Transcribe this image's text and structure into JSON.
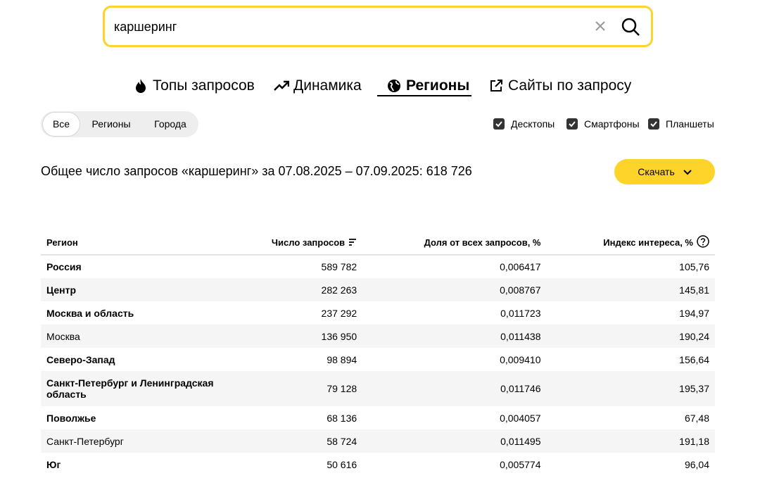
{
  "search": {
    "value": "каршеринг"
  },
  "tabs": [
    {
      "label": "Топы запросов",
      "icon": "fire-icon"
    },
    {
      "label": "Динамика",
      "icon": "trend-up-icon"
    },
    {
      "label": "Регионы",
      "icon": "globe-icon",
      "active": true
    },
    {
      "label": "Сайты по запросу",
      "icon": "external-link-icon"
    }
  ],
  "segments": [
    {
      "label": "Все",
      "active": true
    },
    {
      "label": "Регионы"
    },
    {
      "label": "Города"
    }
  ],
  "devices": [
    {
      "label": "Десктопы",
      "checked": true
    },
    {
      "label": "Смартфоны",
      "checked": true
    },
    {
      "label": "Планшеты",
      "checked": true
    }
  ],
  "summary": "Общее число запросов «каршеринг» за 07.08.2025 – 07.09.2025: 618 726",
  "download_label": "Скачать",
  "table": {
    "headers": {
      "region": "Регион",
      "count": "Число запросов",
      "share": "Доля от всех запросов, %",
      "index": "Индекс интереса, %"
    },
    "rows": [
      {
        "region": "Россия",
        "count": "589 782",
        "share": "0,006417",
        "index": "105,76",
        "bold": true
      },
      {
        "region": "Центр",
        "count": "282 263",
        "share": "0,008767",
        "index": "145,81",
        "bold": true
      },
      {
        "region": "Москва и область",
        "count": "237 292",
        "share": "0,011723",
        "index": "194,97",
        "bold": true
      },
      {
        "region": "Москва",
        "count": "136 950",
        "share": "0,011438",
        "index": "190,24",
        "bold": false
      },
      {
        "region": "Северо-Запад",
        "count": "98 894",
        "share": "0,009410",
        "index": "156,64",
        "bold": true
      },
      {
        "region": "Санкт-Петербург и Ленинградская область",
        "count": "79 128",
        "share": "0,011746",
        "index": "195,37",
        "bold": true
      },
      {
        "region": "Поволжье",
        "count": "68 136",
        "share": "0,004057",
        "index": "67,48",
        "bold": true
      },
      {
        "region": "Санкт-Петербург",
        "count": "58 724",
        "share": "0,011495",
        "index": "191,18",
        "bold": false
      },
      {
        "region": "Юг",
        "count": "50 616",
        "share": "0,005774",
        "index": "96,04",
        "bold": true
      }
    ]
  },
  "colors": {
    "accent": "#fed42b",
    "stripe": "#f5f5f5"
  }
}
